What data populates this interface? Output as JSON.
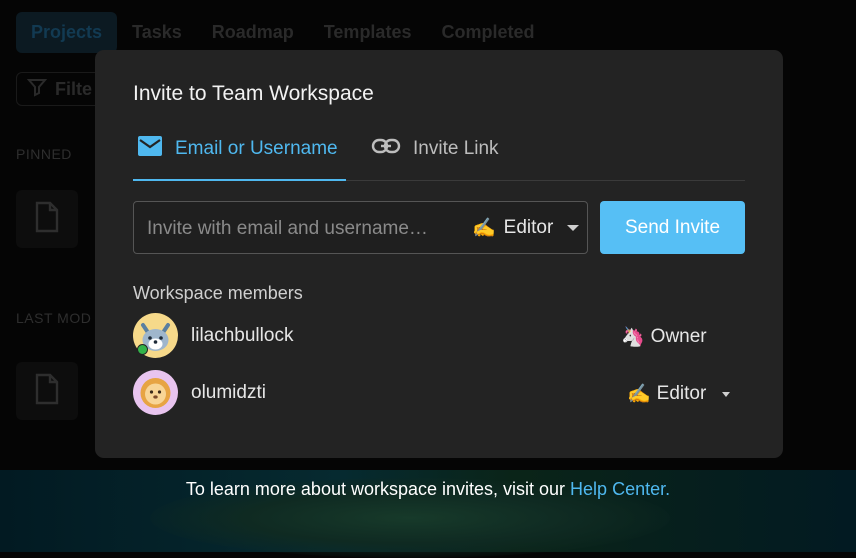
{
  "background": {
    "tabs": [
      "Projects",
      "Tasks",
      "Roadmap",
      "Templates",
      "Completed"
    ],
    "filter_label": "Filte",
    "section_pinned": "PINNED",
    "section_last_modified": "LAST MOD"
  },
  "modal": {
    "title": "Invite to Team Workspace",
    "tabs": [
      {
        "label": "Email or Username",
        "icon": "mail-icon",
        "active": true
      },
      {
        "label": "Invite Link",
        "icon": "link-icon",
        "active": false
      }
    ],
    "input": {
      "placeholder": "Invite with email and username…",
      "value": ""
    },
    "role_select": {
      "emoji": "✍️",
      "label": "Editor"
    },
    "send_label": "Send Invite",
    "members_label": "Workspace members",
    "members": [
      {
        "name": "lilachbullock",
        "role_emoji": "🦄",
        "role": "Owner",
        "online": true
      },
      {
        "name": "olumidzti",
        "role_emoji": "✍️",
        "role": "Editor",
        "online": false
      }
    ]
  },
  "footer": {
    "text": "To learn more about workspace invites, visit our ",
    "link": "Help Center."
  },
  "colors": {
    "accent": "#4fb8ef",
    "button": "#56bff5",
    "modal_bg": "#232323",
    "online": "#33b34a"
  }
}
